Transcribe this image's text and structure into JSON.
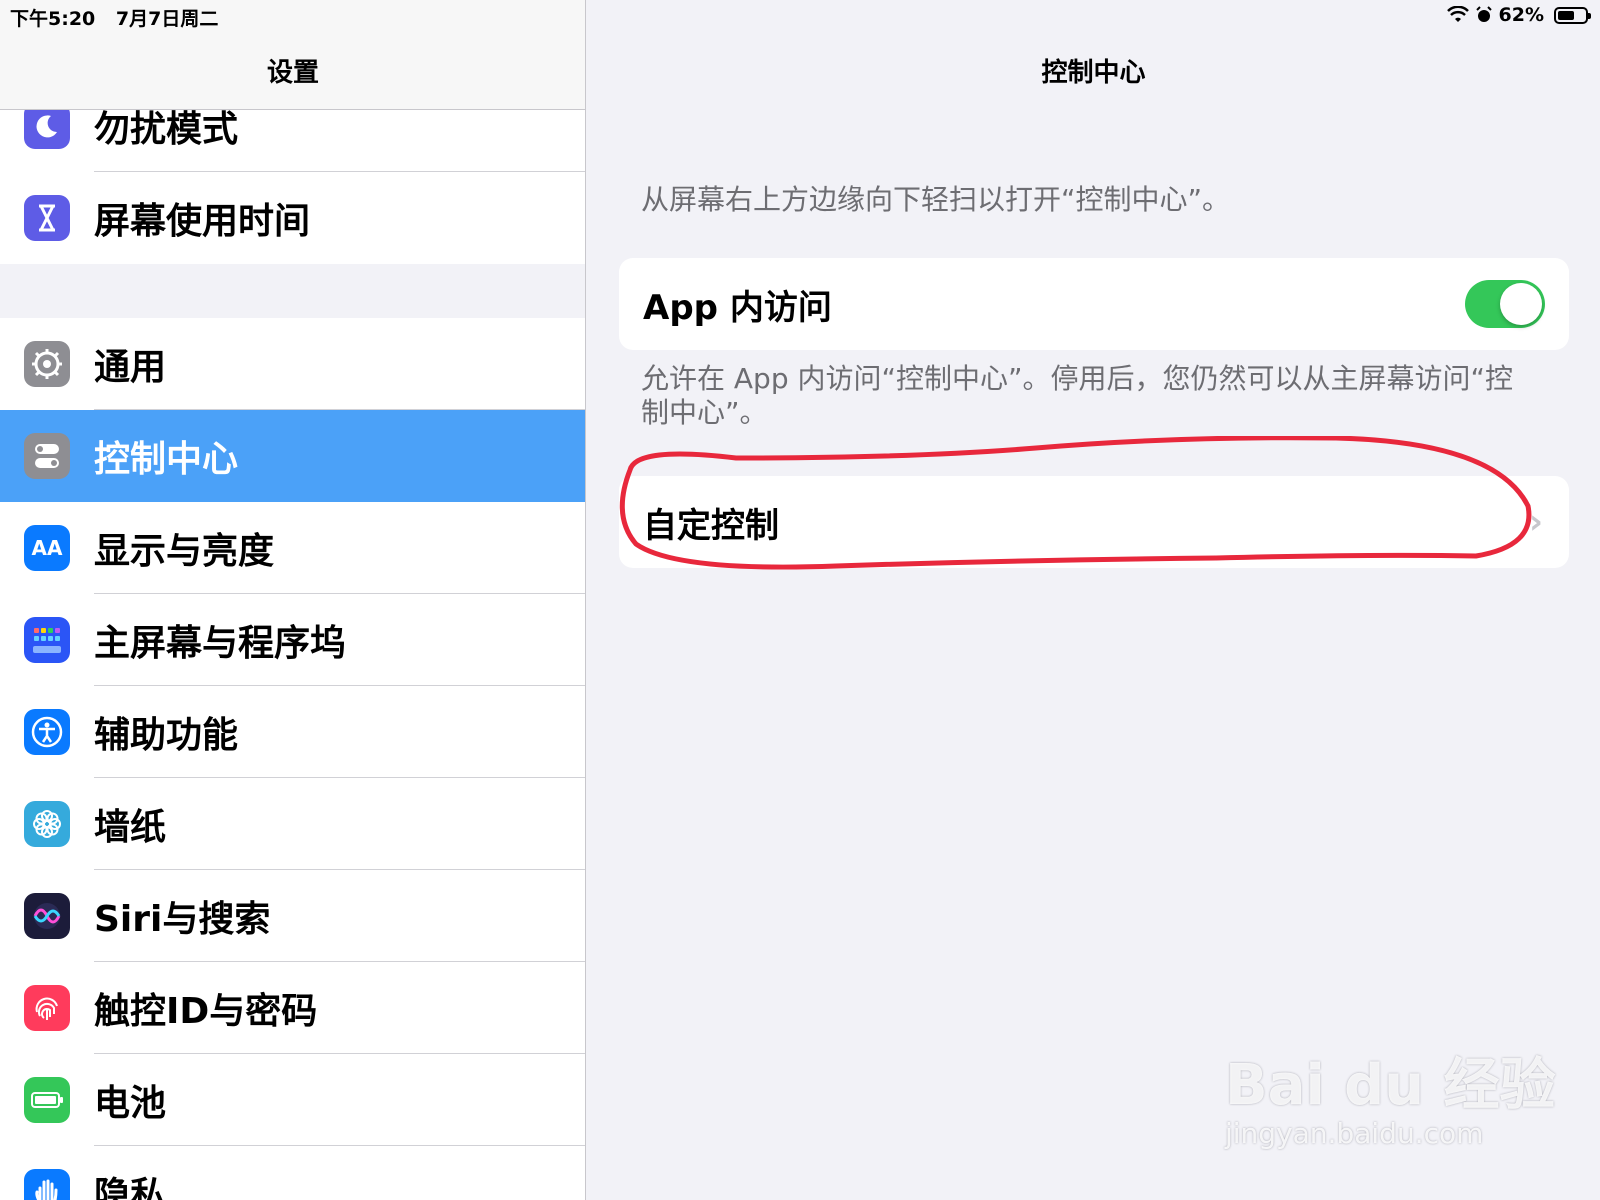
{
  "status_bar": {
    "time": "下午5:20",
    "date": "7月7日周二",
    "battery_percent": "62%",
    "battery_level": 0.62
  },
  "sidebar": {
    "title": "设置",
    "group1": [
      {
        "label": "勿扰模式",
        "icon": "moon-icon",
        "color": "#5e5ce6"
      },
      {
        "label": "屏幕使用时间",
        "icon": "hourglass-icon",
        "color": "#5e5ce6"
      }
    ],
    "group2": [
      {
        "label": "通用",
        "icon": "gear-icon",
        "color": "#8e8e93"
      },
      {
        "label": "控制中心",
        "icon": "switches-icon",
        "color": "#8e8e93",
        "selected": true
      },
      {
        "label": "显示与亮度",
        "icon": "text-size-icon",
        "color": "#0a7aff"
      },
      {
        "label": "主屏幕与程序坞",
        "icon": "home-grid-icon",
        "color": "#2b55f6"
      },
      {
        "label": "辅助功能",
        "icon": "accessibility-icon",
        "color": "#0a7aff"
      },
      {
        "label": "墙纸",
        "icon": "flower-icon",
        "color": "#35aadc"
      },
      {
        "label": "Siri与搜索",
        "icon": "siri-icon",
        "color": "#222"
      },
      {
        "label": "触控ID与密码",
        "icon": "fingerprint-icon",
        "color": "#ff3b5c"
      },
      {
        "label": "电池",
        "icon": "battery-icon",
        "color": "#34c759"
      },
      {
        "label": "隐私",
        "icon": "hand-icon",
        "color": "#0a7aff"
      }
    ]
  },
  "main": {
    "title": "控制中心",
    "hint": "从屏幕右上方边缘向下轻扫以打开“控制中心”。",
    "in_app_access_label": "App 内访问",
    "in_app_access_on": true,
    "description": "允许在 App 内访问“控制中心”。停用后，您仍然可以从主屏幕访问“控制中心”。",
    "customize_label": "自定控制",
    "highlight_color": "#e8283c"
  },
  "watermark": {
    "brand": "Bai du 经验",
    "url": "jingyan.baidu.com"
  }
}
